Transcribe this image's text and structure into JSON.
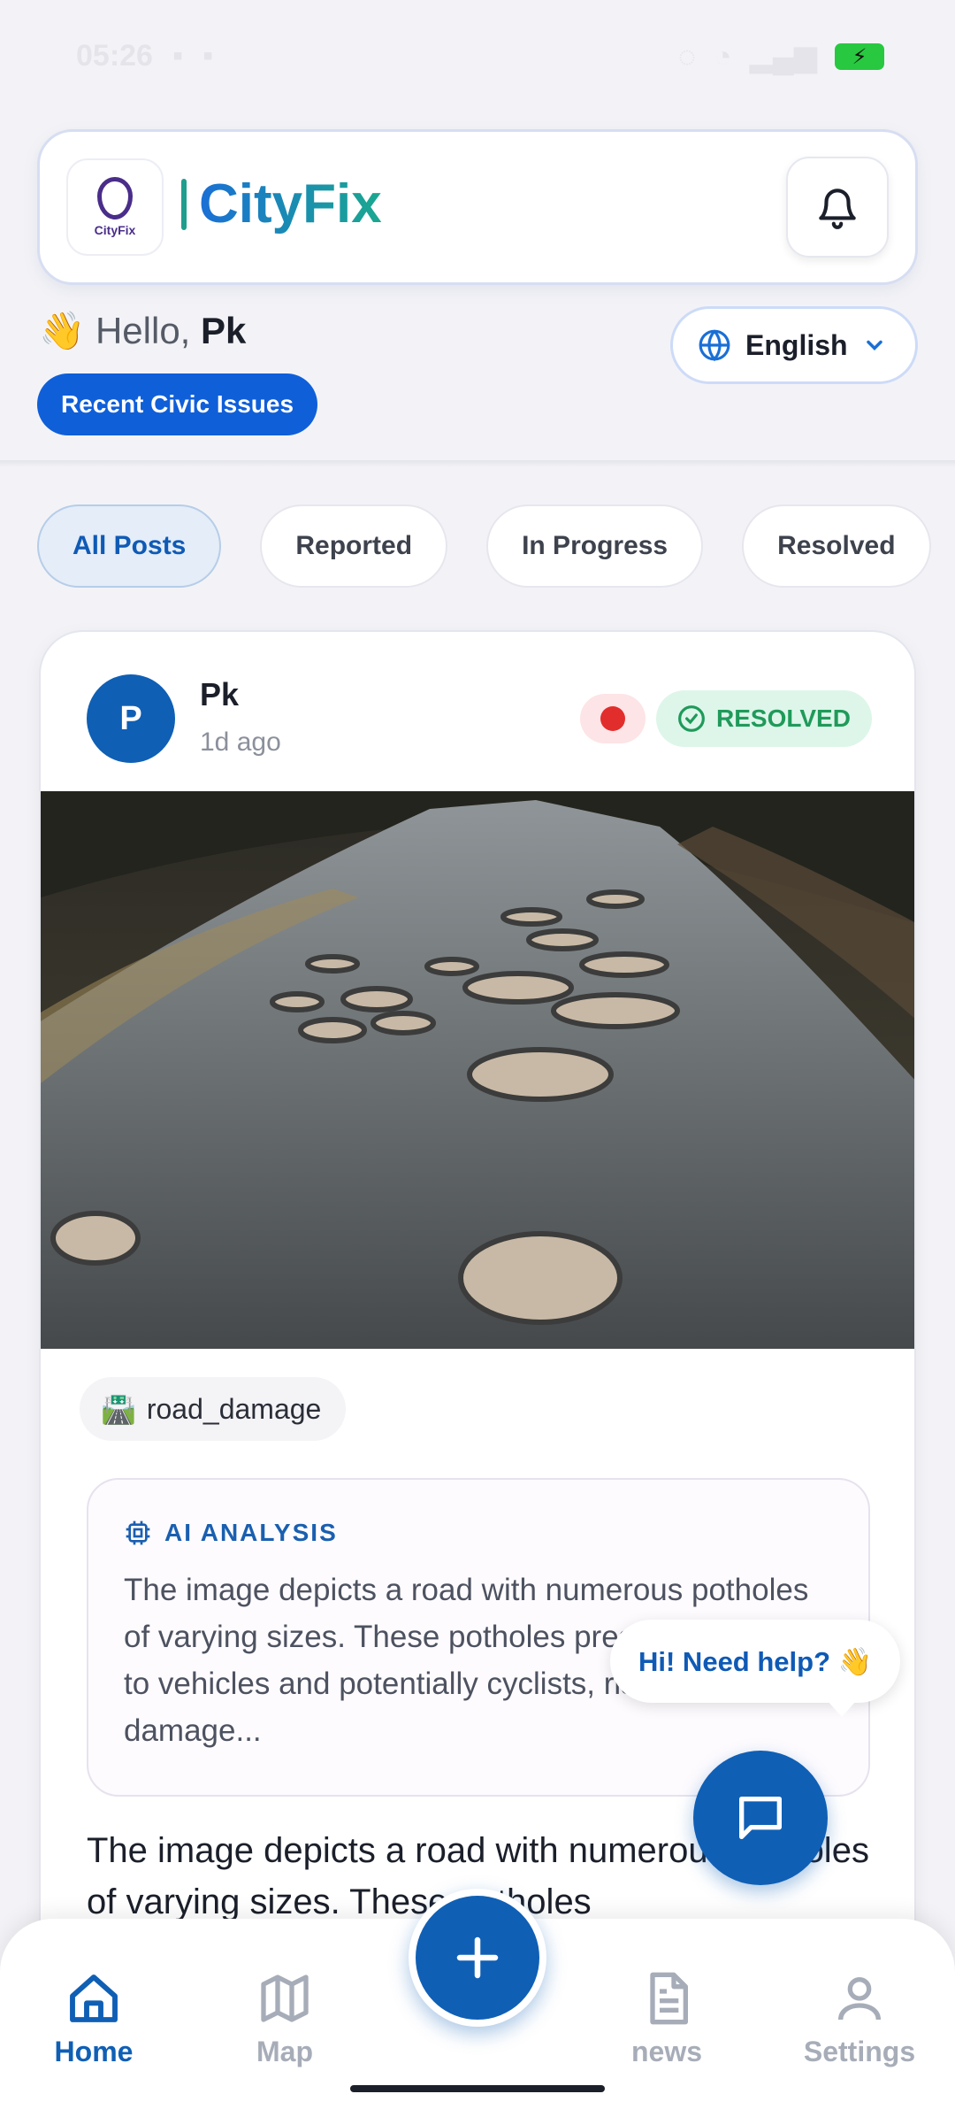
{
  "status_bar": {
    "time": "05:26"
  },
  "header": {
    "logo_text": "CityFix",
    "app_name": "CityFix"
  },
  "greeting": {
    "prefix": "👋 Hello, ",
    "user": "Pk"
  },
  "recent_label": "Recent Civic Issues",
  "language": {
    "selected": "English"
  },
  "tabs": [
    {
      "label": "All Posts"
    },
    {
      "label": "Reported"
    },
    {
      "label": "In Progress"
    },
    {
      "label": "Resolved"
    }
  ],
  "post": {
    "avatar_initial": "P",
    "author": "Pk",
    "time": "1d ago",
    "status": "RESOLVED",
    "category": "road_damage",
    "ai_title": "AI ANALYSIS",
    "ai_text": "The image depicts a road with numerous potholes of varying sizes. These potholes present a hazard to vehicles and potentially cyclists, risking damage...",
    "description": "The image depicts a road with numerous potholes of varying sizes. These potholes"
  },
  "help_bubble": "Hi! Need help? 👋",
  "bottom_nav": [
    {
      "label": "Home",
      "icon": "home-icon"
    },
    {
      "label": "Map",
      "icon": "map-icon"
    },
    {
      "label": "news",
      "icon": "document-icon"
    },
    {
      "label": "Settings",
      "icon": "user-icon"
    }
  ],
  "colors": {
    "primary": "#0f5fb5",
    "resolved": "#1f9a5a",
    "priority": "#e22d2d"
  }
}
